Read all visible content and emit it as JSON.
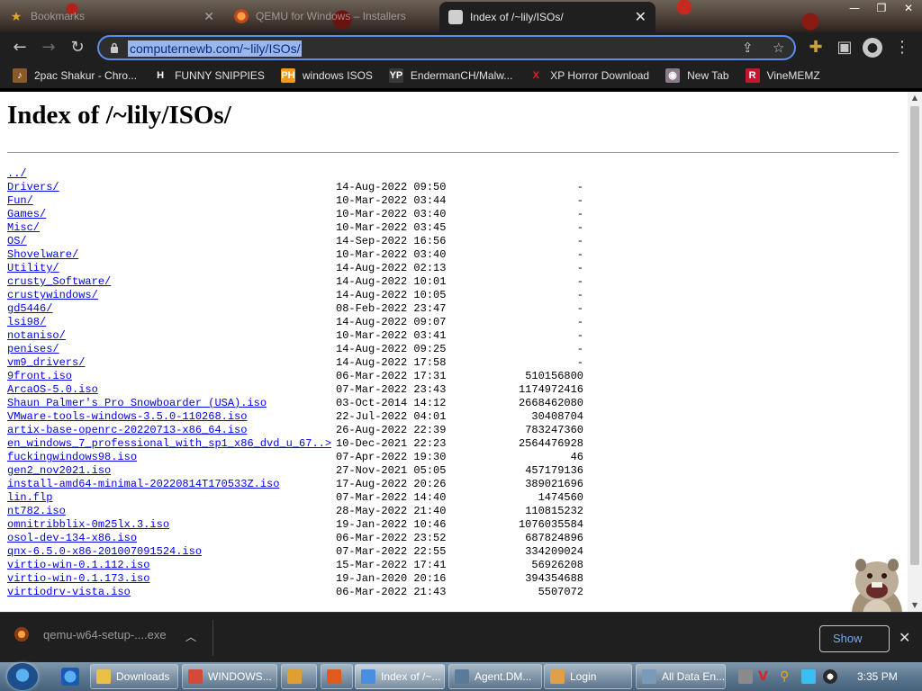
{
  "tabs": [
    {
      "title": "Bookmarks",
      "icon": "star-icon"
    },
    {
      "title": "QEMU for Windows – Installers",
      "icon": "qemu-icon"
    },
    {
      "title": "Index of /~lily/ISOs/",
      "icon": "page-icon",
      "active": true
    }
  ],
  "window_controls": {
    "minimize": "—",
    "restore": "❐",
    "close": "✕"
  },
  "address": {
    "url": "computernewb.com/~lily/ISOs/"
  },
  "bookmarks": [
    {
      "label": "2pac Shakur - Chro...",
      "icon": "bookmark-favicon-1",
      "color": "#8a5a2a",
      "glyph": "♪"
    },
    {
      "label": "FUNNY SNIPPIES",
      "icon": "h-icon",
      "color": "#1f1f1f",
      "glyph": "H"
    },
    {
      "label": "windows ISOS",
      "icon": "ph-icon",
      "color": "#f79a17",
      "glyph": "PH"
    },
    {
      "label": "EndermanCH/Malw...",
      "icon": "yp-icon",
      "color": "#3a3a3a",
      "glyph": "YP"
    },
    {
      "label": "XP Horror Download",
      "icon": "x-icon",
      "color": "#1f1f1f",
      "glyph": "X"
    },
    {
      "label": "New Tab",
      "icon": "newtab-icon",
      "color": "#8a7a8a",
      "glyph": "◉"
    },
    {
      "label": "VineMEMZ",
      "icon": "r-icon",
      "color": "#c4162f",
      "glyph": "R"
    }
  ],
  "page": {
    "title": "Index of /~lily/ISOs/",
    "entries": [
      {
        "name": "../",
        "date": "",
        "size": ""
      },
      {
        "name": "Drivers/",
        "date": "14-Aug-2022 09:50",
        "size": "-"
      },
      {
        "name": "Fun/",
        "date": "10-Mar-2022 03:44",
        "size": "-"
      },
      {
        "name": "Games/",
        "date": "10-Mar-2022 03:40",
        "size": "-"
      },
      {
        "name": "Misc/",
        "date": "10-Mar-2022 03:45",
        "size": "-"
      },
      {
        "name": "OS/",
        "date": "14-Sep-2022 16:56",
        "size": "-"
      },
      {
        "name": "Shovelware/",
        "date": "10-Mar-2022 03:40",
        "size": "-"
      },
      {
        "name": "Utility/",
        "date": "14-Aug-2022 02:13",
        "size": "-"
      },
      {
        "name": "crusty_Software/",
        "date": "14-Aug-2022 10:01",
        "size": "-"
      },
      {
        "name": "crustywindows/",
        "date": "14-Aug-2022 10:05",
        "size": "-"
      },
      {
        "name": "gd5446/",
        "date": "08-Feb-2022 23:47",
        "size": "-"
      },
      {
        "name": "lsi98/",
        "date": "14-Aug-2022 09:07",
        "size": "-"
      },
      {
        "name": "notaniso/",
        "date": "10-Mar-2022 03:41",
        "size": "-"
      },
      {
        "name": "penises/",
        "date": "14-Aug-2022 09:25",
        "size": "-"
      },
      {
        "name": "vm9_drivers/",
        "date": "14-Aug-2022 17:58",
        "size": "-"
      },
      {
        "name": "9front.iso",
        "date": "06-Mar-2022 17:31",
        "size": "510156800"
      },
      {
        "name": "ArcaOS-5.0.iso",
        "date": "07-Mar-2022 23:43",
        "size": "1174972416"
      },
      {
        "name": "Shaun Palmer's Pro Snowboarder (USA).iso",
        "date": "03-Oct-2014 14:12",
        "size": "2668462080"
      },
      {
        "name": "VMware-tools-windows-3.5.0-110268.iso",
        "date": "22-Jul-2022 04:01",
        "size": "30408704"
      },
      {
        "name": "artix-base-openrc-20220713-x86_64.iso",
        "date": "26-Aug-2022 22:39",
        "size": "783247360"
      },
      {
        "name": "en_windows_7_professional_with_sp1_x86_dvd_u_67..>",
        "date": "10-Dec-2021 22:23",
        "size": "2564476928"
      },
      {
        "name": "fuckingwindows98.iso",
        "date": "07-Apr-2022 19:30",
        "size": "46"
      },
      {
        "name": "gen2_nov2021.iso",
        "date": "27-Nov-2021 05:05",
        "size": "457179136"
      },
      {
        "name": "install-amd64-minimal-20220814T170533Z.iso",
        "date": "17-Aug-2022 20:26",
        "size": "389021696"
      },
      {
        "name": "lin.flp",
        "date": "07-Mar-2022 14:40",
        "size": "1474560"
      },
      {
        "name": "nt782.iso",
        "date": "28-May-2022 21:40",
        "size": "110815232"
      },
      {
        "name": "omnitribblix-0m25lx.3.iso",
        "date": "19-Jan-2022 10:46",
        "size": "1076035584"
      },
      {
        "name": "osol-dev-134-x86.iso",
        "date": "06-Mar-2022 23:52",
        "size": "687824896"
      },
      {
        "name": "qnx-6.5.0-x86-201007091524.iso",
        "date": "07-Mar-2022 22:55",
        "size": "334209024"
      },
      {
        "name": "virtio-win-0.1.112.iso",
        "date": "15-Mar-2022 17:41",
        "size": "56926208"
      },
      {
        "name": "virtio-win-0.1.173.iso",
        "date": "19-Jan-2020 20:16",
        "size": "394354688"
      },
      {
        "name": "virtiodrv-vista.iso",
        "date": "06-Mar-2022 21:43",
        "size": "5507072"
      }
    ]
  },
  "download": {
    "filename": "qemu-w64-setup-....exe",
    "show_all_label": "Show"
  },
  "taskbar": {
    "tasks": [
      {
        "label": "Downloads",
        "icon": "explorer-icon",
        "color": "#e8c04a"
      },
      {
        "label": "WINDOWS...",
        "icon": "windows-icon",
        "color": "#d24a3a"
      },
      {
        "label": "",
        "icon": "media-icon",
        "color": "#e0a030"
      },
      {
        "label": "",
        "icon": "app-icon",
        "color": "#e05a20"
      },
      {
        "label": "Index of /~...",
        "icon": "chrome-icon",
        "color": "#4a8ee0",
        "active": true
      },
      {
        "label": "Agent.DM...",
        "icon": "window-icon",
        "color": "#5a7a9a"
      },
      {
        "label": "Login",
        "icon": "login-icon",
        "color": "#e0a04a"
      },
      {
        "label": "All Data En...",
        "icon": "data-icon",
        "color": "#7a9aba"
      }
    ],
    "clock": "3:35 PM"
  }
}
